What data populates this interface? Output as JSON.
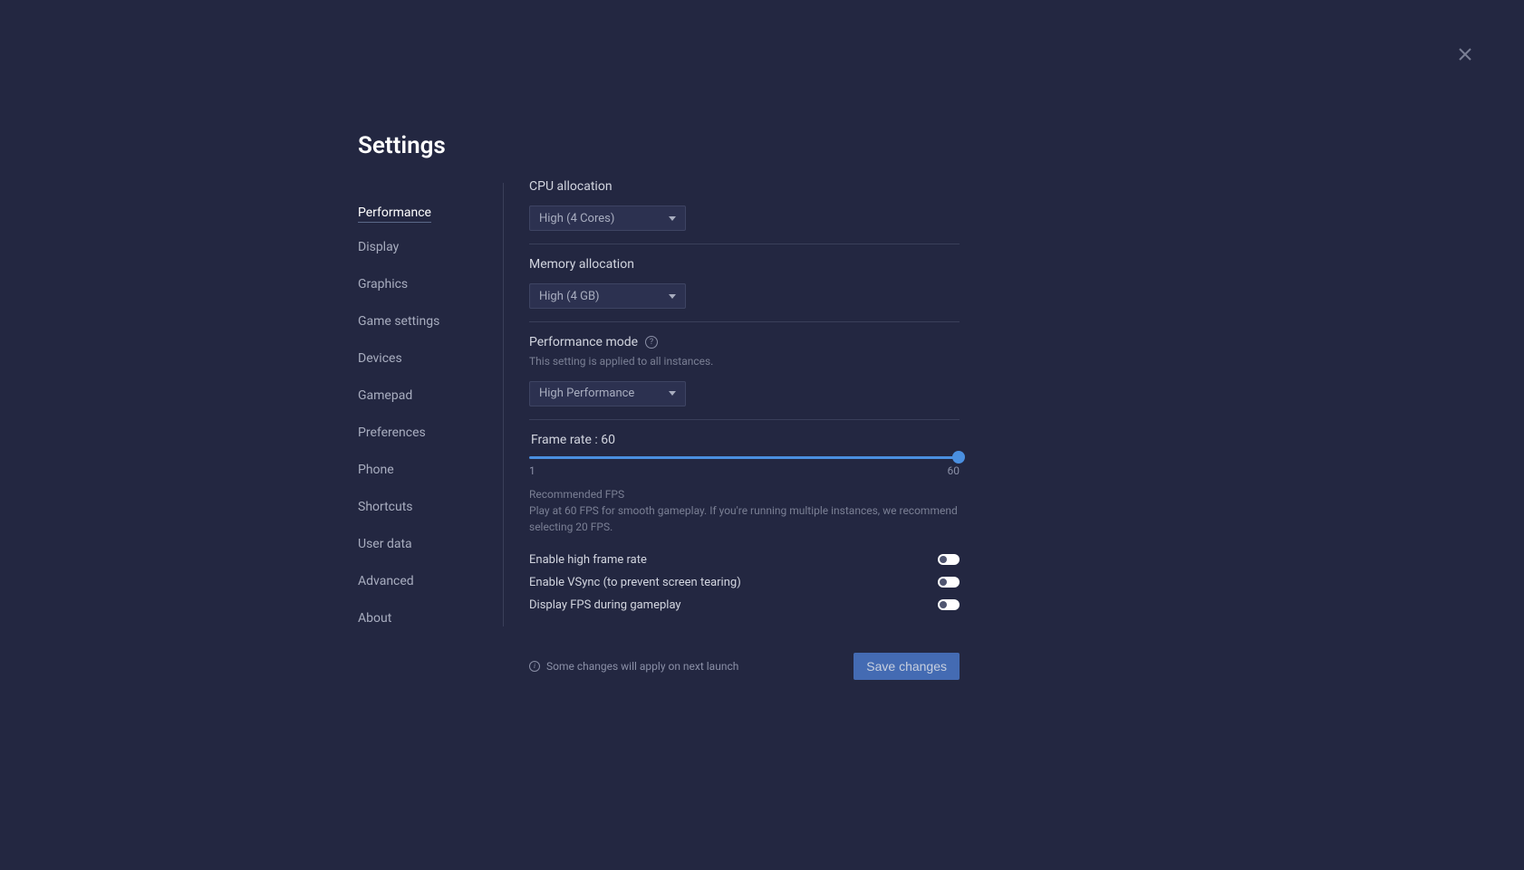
{
  "title": "Settings",
  "nav": {
    "items": [
      {
        "label": "Performance",
        "active": true
      },
      {
        "label": "Display"
      },
      {
        "label": "Graphics"
      },
      {
        "label": "Game settings"
      },
      {
        "label": "Devices"
      },
      {
        "label": "Gamepad"
      },
      {
        "label": "Preferences"
      },
      {
        "label": "Phone"
      },
      {
        "label": "Shortcuts"
      },
      {
        "label": "User data"
      },
      {
        "label": "Advanced"
      },
      {
        "label": "About"
      }
    ]
  },
  "cpu": {
    "label": "CPU allocation",
    "value": "High (4 Cores)"
  },
  "memory": {
    "label": "Memory allocation",
    "value": "High (4 GB)"
  },
  "perfmode": {
    "label": "Performance mode",
    "note": "This setting is applied to all instances.",
    "value": "High Performance"
  },
  "framerate": {
    "label_prefix": "Frame rate : ",
    "value": "60",
    "min": "1",
    "max": "60",
    "rec_title": "Recommended FPS",
    "rec_text": "Play at 60 FPS for smooth gameplay. If you're running multiple instances, we recommend selecting 20 FPS."
  },
  "toggles": {
    "high_frame": "Enable high frame rate",
    "vsync": "Enable VSync (to prevent screen tearing)",
    "display_fps": "Display FPS during gameplay"
  },
  "footer": {
    "note": "Some changes will apply on next launch",
    "save": "Save changes"
  }
}
